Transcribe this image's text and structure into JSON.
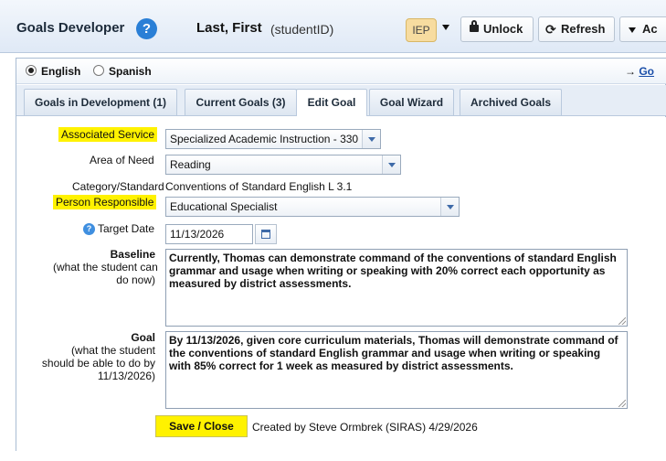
{
  "header": {
    "app_title": "Goals Developer",
    "help_glyph": "?",
    "student_name": "Last, First",
    "student_id": "(studentID)",
    "iep_label": "IEP",
    "unlock_label": "Unlock",
    "refresh_label": "Refresh",
    "actions_label": "Ac"
  },
  "language": {
    "english_label": "English",
    "spanish_label": "Spanish",
    "selected": "English",
    "goto_arrow": "→",
    "goto_label": "Go"
  },
  "tabs": [
    {
      "label": "Goals in Development (1)",
      "active": false
    },
    {
      "label": "Current Goals (3)",
      "active": false
    },
    {
      "label": "Edit Goal",
      "active": true
    },
    {
      "label": "Goal Wizard",
      "active": false
    },
    {
      "label": "Archived Goals",
      "active": false
    }
  ],
  "form": {
    "associated_service_label": "Associated Service",
    "associated_service_value": "Specialized Academic Instruction - 330",
    "area_of_need_label": "Area of Need",
    "area_of_need_value": "Reading",
    "category_label": "Category/Standard",
    "category_value": "Conventions of Standard English L 3.1",
    "person_responsible_label": "Person Responsible",
    "person_responsible_value": "Educational Specialist",
    "target_date_label": "Target Date",
    "target_date_value": "11/13/2026",
    "baseline_label": "Baseline",
    "baseline_sub_1": "(what the student can",
    "baseline_sub_2": "do now)",
    "baseline_text": "Currently, Thomas  can demonstrate command of the conventions of standard English grammar and usage when writing or speaking with 20% correct each opportunity as measured by district assessments.",
    "goal_label": "Goal",
    "goal_sub_1": "(what the student",
    "goal_sub_2": "should be able to do by",
    "goal_sub_3": "11/13/2026)",
    "goal_text": "By 11/13/2026, given core curriculum materials, Thomas will demonstrate command of the conventions of standard English grammar and usage when writing or speaking with 85% correct for 1 week  as measured by district assessments."
  },
  "footer": {
    "save_label": "Save / Close",
    "created_by": "Created by Steve Ormbrek (SIRAS) 4/29/2026"
  },
  "colors": {
    "highlight": "#fff200",
    "help_icon": "#2a7fd6",
    "iep_badge": "#f7dca0",
    "header_bg": "#dfe9f6"
  },
  "icons": {
    "help": "question-circle-icon",
    "lock": "lock-icon",
    "refresh": "refresh-icon",
    "calendar": "calendar-icon",
    "info": "info-circle-icon"
  }
}
